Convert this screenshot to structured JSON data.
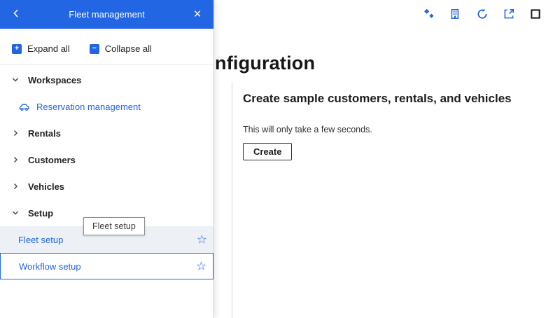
{
  "colors": {
    "accent": "#2266E3"
  },
  "panel": {
    "title": "Fleet management",
    "close_icon": "×",
    "toolbar": {
      "expand_all": "Expand all",
      "collapse_all": "Collapse all",
      "expand_glyph": "+",
      "collapse_glyph": "−"
    },
    "tree": [
      {
        "label": "Workspaces",
        "type": "group",
        "state": "expanded"
      },
      {
        "label": "Reservation management",
        "type": "link",
        "icon": "car-icon"
      },
      {
        "label": "Rentals",
        "type": "group",
        "state": "collapsed"
      },
      {
        "label": "Customers",
        "type": "group",
        "state": "collapsed"
      },
      {
        "label": "Vehicles",
        "type": "group",
        "state": "collapsed"
      },
      {
        "label": "Setup",
        "type": "group",
        "state": "expanded"
      },
      {
        "label": "Fleet setup",
        "type": "link",
        "star": "☆",
        "highlighted": true
      },
      {
        "label": "Workflow setup",
        "type": "link",
        "star": "☆",
        "focused": true
      }
    ],
    "tooltip": "Fleet setup"
  },
  "topbar": {
    "icons": [
      "copilot-diamonds-icon",
      "company-icon",
      "refresh-icon",
      "open-in-new-window-icon",
      "maximize-icon"
    ]
  },
  "main": {
    "title_fragment": "nfiguration",
    "section": {
      "heading": "Create sample customers, rentals, and vehicles",
      "note": "This will only take a few seconds.",
      "create_button": "Create"
    }
  }
}
